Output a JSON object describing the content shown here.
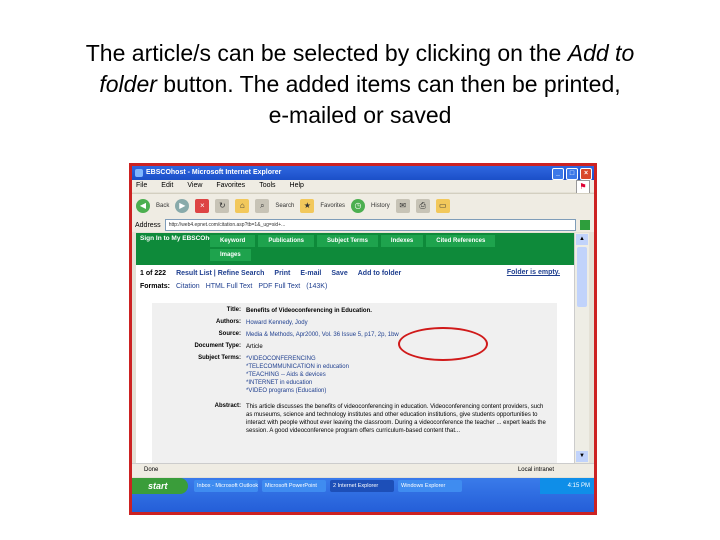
{
  "heading": {
    "line1_a": "The article/s can be selected by clicking on the ",
    "line1_b": "Add to",
    "line2_a": "folder",
    "line2_b": " button. The added items can then be printed,",
    "line3": "e-mailed or saved"
  },
  "window": {
    "title": "EBSCOhost - Microsoft Internet Explorer",
    "menu": [
      "File",
      "Edit",
      "View",
      "Favorites",
      "Tools",
      "Help"
    ],
    "toolbar": {
      "back": "Back",
      "search": "Search",
      "favorites": "Favorites",
      "history": "History"
    },
    "address_label": "Address",
    "address": "http://web4.epnet.com/citation.asp?tb=1&_ug=sid+...",
    "go": "Go",
    "links": "Links"
  },
  "ebsco": {
    "signin": "Sign In to My EBSCOhost",
    "tabs": [
      "Keyword",
      "Publications",
      "Subject Terms",
      "Indexes",
      "Cited References"
    ],
    "tab_row2": "Images",
    "result_count": "1 of 222",
    "result_links": "Result List | Refine Search",
    "actions": {
      "print": "Print",
      "email": "E-mail",
      "save": "Save",
      "add": "Add to folder"
    },
    "folder_status": "Folder is empty.",
    "formats_label": "Formats:",
    "formats": [
      "Citation",
      "HTML Full Text",
      "PDF Full Text"
    ],
    "pdf_size": "(143K)"
  },
  "record": {
    "title_k": "Title:",
    "title_v": "Benefits of Videoconferencing in Education.",
    "authors_k": "Authors:",
    "authors_v": "Howard Kennedy, Jody",
    "source_k": "Source:",
    "source_v": "Media & Methods, Apr2000, Vol. 36 Issue 5, p17, 2p, 1bw",
    "doctype_k": "Document Type:",
    "doctype_v": "Article",
    "subject_k": "Subject Terms:",
    "subjects": [
      "*VIDEOCONFERENCING",
      "*TELECOMMUNICATION in education",
      "*TEACHING -- Aids & devices",
      "*INTERNET in education",
      "*VIDEO programs (Education)"
    ],
    "abstract_k": "Abstract:",
    "abstract_v": "This article discusses the benefits of videoconferencing in education. Videoconferencing content providers, such as museums, science and technology institutes and other education institutions, give students opportunities to interact with people without ever leaving the classroom. During a videoconference the teacher ... expert leads the session. A good videoconference program offers curriculum-based content that..."
  },
  "status": {
    "left": "Done",
    "zone": "Local intranet"
  },
  "taskbar": {
    "start": "start",
    "items": [
      "Inbox - Microsoft Outlook",
      "Microsoft PowerPoint",
      "2 Internet Explorer",
      "Windows Explorer"
    ],
    "clock": "4:15 PM"
  },
  "colors": {
    "green": "#0e8a3a",
    "highlight": "#d01a1a",
    "frame": "#cc2222"
  }
}
